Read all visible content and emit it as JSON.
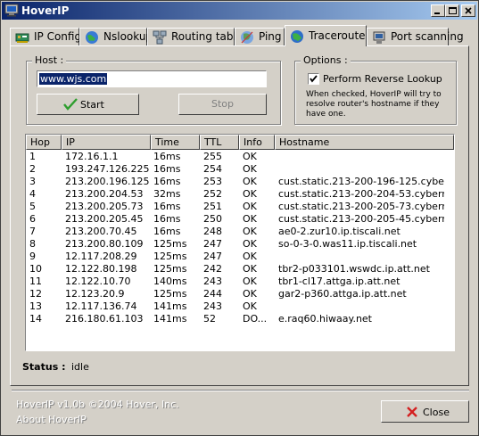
{
  "window": {
    "title": "HoverIP"
  },
  "tabs": [
    {
      "label": "IP Config",
      "icon": "network-card-icon"
    },
    {
      "label": "Nslookup",
      "icon": "globe-icon"
    },
    {
      "label": "Routing table",
      "icon": "network-icon"
    },
    {
      "label": "Ping",
      "icon": "ping-globe-icon"
    },
    {
      "label": "Traceroute",
      "icon": "traceroute-globe-icon"
    },
    {
      "label": "Port scanning",
      "icon": "computer-port-icon"
    }
  ],
  "active_tab": "Traceroute",
  "host": {
    "group_label": "Host :",
    "value": "www.wjs.com",
    "start_label": "Start",
    "stop_label": "Stop"
  },
  "options": {
    "group_label": "Options :",
    "reverse_lookup_label": "Perform Reverse Lookup",
    "reverse_lookup_checked": true,
    "description": "When checked, HoverIP will try to resolve router's hostname if they have one."
  },
  "table": {
    "columns": [
      "Hop",
      "IP",
      "Time",
      "TTL",
      "Info",
      "Hostname"
    ],
    "rows": [
      [
        "1",
        "172.16.1.1",
        "16ms",
        "255",
        "OK",
        ""
      ],
      [
        "2",
        "193.247.126.225",
        "16ms",
        "254",
        "OK",
        ""
      ],
      [
        "3",
        "213.200.196.125",
        "16ms",
        "253",
        "OK",
        "cust.static.213-200-196-125.cyber..."
      ],
      [
        "4",
        "213.200.204.53",
        "32ms",
        "252",
        "OK",
        "cust.static.213-200-204-53.cybern..."
      ],
      [
        "5",
        "213.200.205.73",
        "16ms",
        "251",
        "OK",
        "cust.static.213-200-205-73.cybern..."
      ],
      [
        "6",
        "213.200.205.45",
        "16ms",
        "250",
        "OK",
        "cust.static.213-200-205-45.cybern..."
      ],
      [
        "7",
        "213.200.70.45",
        "16ms",
        "248",
        "OK",
        "ae0-2.zur10.ip.tiscali.net"
      ],
      [
        "8",
        "213.200.80.109",
        "125ms",
        "247",
        "OK",
        "so-0-3-0.was11.ip.tiscali.net"
      ],
      [
        "9",
        "12.117.208.29",
        "125ms",
        "247",
        "OK",
        ""
      ],
      [
        "10",
        "12.122.80.198",
        "125ms",
        "242",
        "OK",
        "tbr2-p033101.wswdc.ip.att.net"
      ],
      [
        "11",
        "12.122.10.70",
        "140ms",
        "243",
        "OK",
        "tbr1-cl17.attga.ip.att.net"
      ],
      [
        "12",
        "12.123.20.9",
        "125ms",
        "244",
        "OK",
        "gar2-p360.attga.ip.att.net"
      ],
      [
        "13",
        "12.117.136.74",
        "141ms",
        "243",
        "OK",
        ""
      ],
      [
        "14",
        "216.180.61.103",
        "141ms",
        "52",
        "DO...",
        "e.raq60.hiwaay.net"
      ]
    ]
  },
  "status": {
    "label": "Status :",
    "value": "idle"
  },
  "footer": {
    "copyright": "HoverIP v1.0b ©2004 Hover, Inc.",
    "about_link": "About HoverIP",
    "close_label": "Close"
  }
}
